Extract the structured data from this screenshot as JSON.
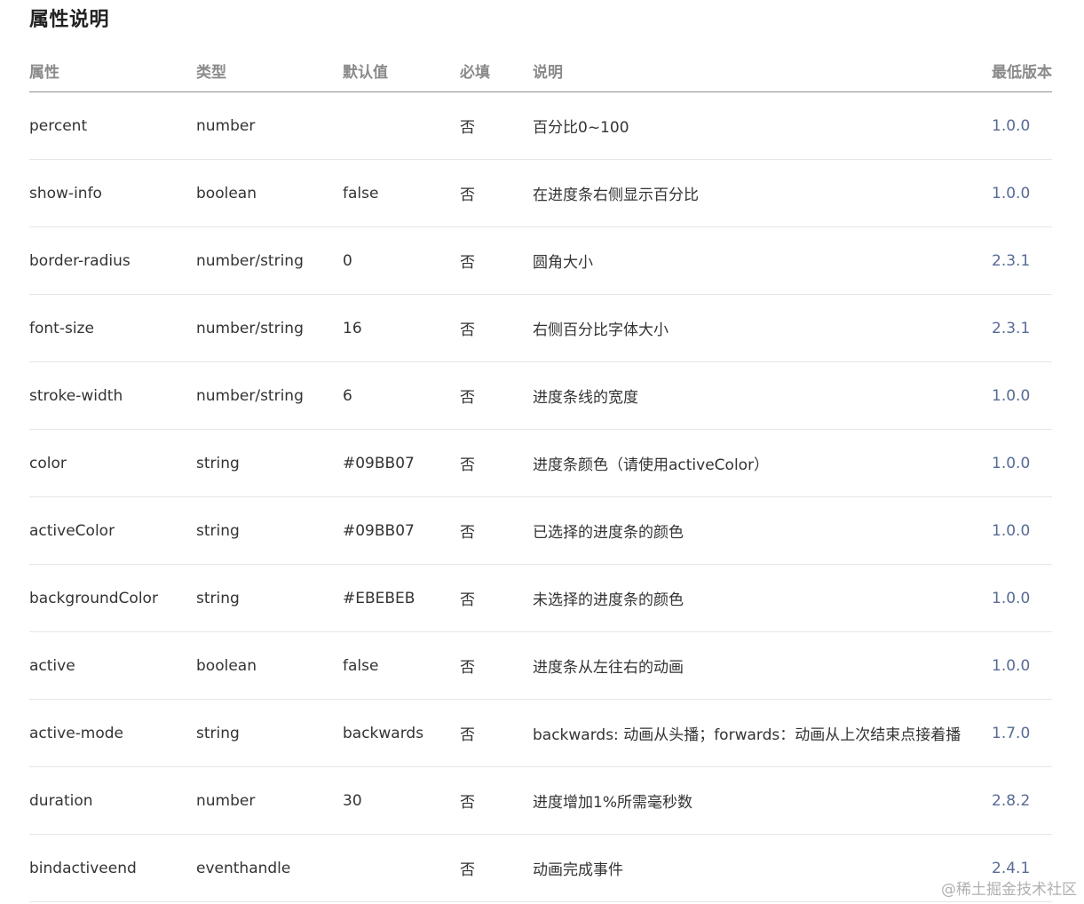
{
  "title": "属性说明",
  "columns": [
    "属性",
    "类型",
    "默认值",
    "必填",
    "说明",
    "最低版本"
  ],
  "rows": [
    {
      "name": "percent",
      "type": "number",
      "default": "",
      "required": "否",
      "desc": "百分比0~100",
      "version": "1.0.0"
    },
    {
      "name": "show-info",
      "type": "boolean",
      "default": "false",
      "required": "否",
      "desc": "在进度条右侧显示百分比",
      "version": "1.0.0"
    },
    {
      "name": "border-radius",
      "type": "number/string",
      "default": "0",
      "required": "否",
      "desc": "圆角大小",
      "version": "2.3.1"
    },
    {
      "name": "font-size",
      "type": "number/string",
      "default": "16",
      "required": "否",
      "desc": "右侧百分比字体大小",
      "version": "2.3.1"
    },
    {
      "name": "stroke-width",
      "type": "number/string",
      "default": "6",
      "required": "否",
      "desc": "进度条线的宽度",
      "version": "1.0.0"
    },
    {
      "name": "color",
      "type": "string",
      "default": "#09BB07",
      "required": "否",
      "desc": "进度条颜色（请使用activeColor）",
      "version": "1.0.0"
    },
    {
      "name": "activeColor",
      "type": "string",
      "default": "#09BB07",
      "required": "否",
      "desc": "已选择的进度条的颜色",
      "version": "1.0.0"
    },
    {
      "name": "backgroundColor",
      "type": "string",
      "default": "#EBEBEB",
      "required": "否",
      "desc": "未选择的进度条的颜色",
      "version": "1.0.0"
    },
    {
      "name": "active",
      "type": "boolean",
      "default": "false",
      "required": "否",
      "desc": "进度条从左往右的动画",
      "version": "1.0.0"
    },
    {
      "name": "active-mode",
      "type": "string",
      "default": "backwards",
      "required": "否",
      "desc": "backwards: 动画从头播；forwards：动画从上次结束点接着播",
      "version": "1.7.0"
    },
    {
      "name": "duration",
      "type": "number",
      "default": "30",
      "required": "否",
      "desc": "进度增加1%所需毫秒数",
      "version": "2.8.2"
    },
    {
      "name": "bindactiveend",
      "type": "eventhandle",
      "default": "",
      "required": "否",
      "desc": "动画完成事件",
      "version": "2.4.1"
    }
  ],
  "watermark": "@稀土掘金技术社区",
  "colors": {
    "text": "#333333",
    "header": "#8a8a8a",
    "version": "#576b95",
    "divider": "#e6e6e6"
  }
}
